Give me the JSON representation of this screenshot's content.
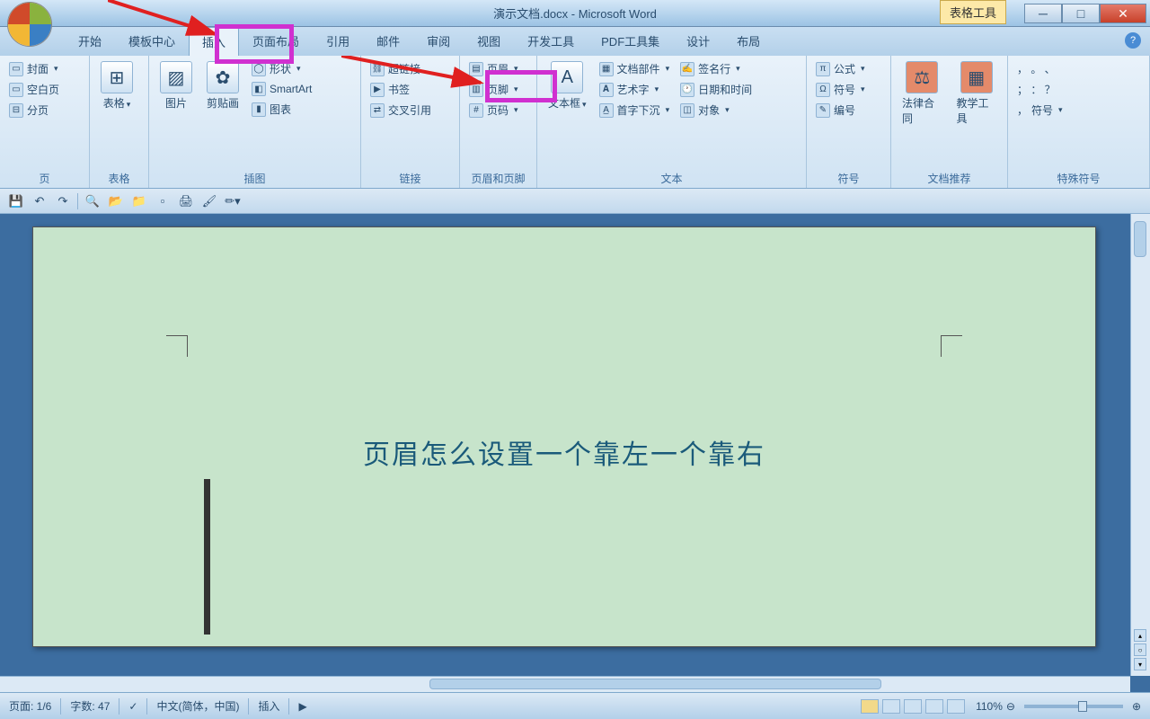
{
  "title": "演示文档.docx - Microsoft Word",
  "contextTab": "表格工具",
  "tabs": [
    "开始",
    "模板中心",
    "插入",
    "页面布局",
    "引用",
    "邮件",
    "审阅",
    "视图",
    "开发工具",
    "PDF工具集",
    "设计",
    "布局"
  ],
  "activeTab": "插入",
  "ribbon": {
    "pages": {
      "label": "页",
      "cover": "封面",
      "blank": "空白页",
      "break": "分页"
    },
    "tables": {
      "label": "表格",
      "btn": "表格"
    },
    "illus": {
      "label": "插图",
      "pic": "图片",
      "clip": "剪贴画",
      "shapes": "形状",
      "smartart": "SmartArt",
      "chart": "图表"
    },
    "links": {
      "label": "链接",
      "hyper": "超链接",
      "bookmark": "书签",
      "crossref": "交叉引用"
    },
    "hf": {
      "label": "页眉和页脚",
      "header": "页眉",
      "footer": "页脚",
      "pagenum": "页码"
    },
    "text": {
      "label": "文本",
      "textbox": "文本框",
      "parts": "文档部件",
      "wordart": "艺术字",
      "dropcap": "首字下沉",
      "sigline": "签名行",
      "datetime": "日期和时间",
      "object": "对象"
    },
    "symbols": {
      "label": "符号",
      "equation": "公式",
      "symbol": "符号",
      "number": "编号"
    },
    "docrec": {
      "label": "文档推荐",
      "legal": "法律合同",
      "teach": "教学工具"
    },
    "special": {
      "label": "特殊符号",
      "sym": "符号"
    }
  },
  "document": {
    "heading": "页眉怎么设置一个靠左一个靠右"
  },
  "status": {
    "page": "页面: 1/6",
    "words": "字数: 47",
    "lang": "中文(简体，中国)",
    "mode": "插入",
    "zoom": "110%"
  }
}
